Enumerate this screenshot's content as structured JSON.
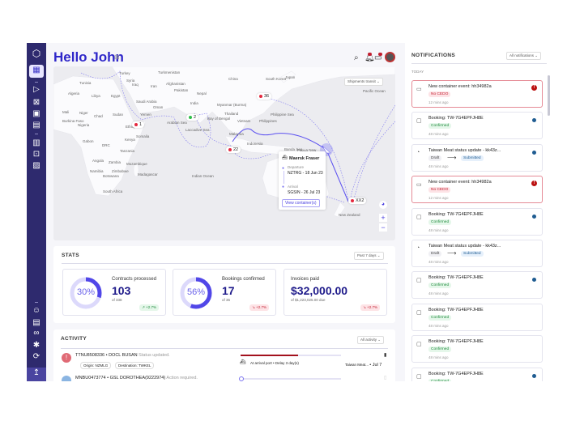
{
  "header": {
    "title": "Hello John"
  },
  "map": {
    "dropdown": "Shipments transit",
    "labels": [
      "Turkey",
      "Turkmenistan",
      "China",
      "South Korea",
      "Japan",
      "Tunisia",
      "Syria",
      "Iraq",
      "Iran",
      "Afghanistan",
      "Pakistan",
      "Nepal",
      "Algeria",
      "Libya",
      "Egypt",
      "Saudi Arabia",
      "Oman",
      "India",
      "Myanmar (Burma)",
      "Mali",
      "Niger",
      "Chad",
      "Sudan",
      "Yemen",
      "Thailand",
      "Vietnam",
      "Philippines",
      "Burkina Faso",
      "Nigeria",
      "Ethiopia",
      "Somalia",
      "Malaysia",
      "Kenya",
      "Gabon",
      "DRC",
      "Indonesia",
      "Tanzania",
      "Papua New",
      "Angola",
      "Zambia",
      "Mozambique",
      "Namibia",
      "Zimbabwe",
      "Madagascar",
      "Botswana",
      "Indian Ocean",
      "South Africa",
      "New Zealand",
      "Pacific Ocean",
      "Arabian Sea",
      "Bay of Bengal",
      "Philippine Sea",
      "Laccadive Sea",
      "Banda Sea",
      "Australia"
    ],
    "pins": [
      {
        "label": "1",
        "color": "#e5283f"
      },
      {
        "label": "2",
        "color": "#2fbf4a"
      },
      {
        "label": "36",
        "color": "#e5283f"
      },
      {
        "label": "22",
        "color": "#e5283f"
      },
      {
        "label": "XX2",
        "color": "#e5283f"
      }
    ],
    "popup": {
      "vessel": "Maersk Fraser",
      "departure_label": "Departure",
      "departure": "NZTRG - 18 Jun 23",
      "arrival_label": "Arrival",
      "arrival": "SGSIN - 26 Jul 23",
      "button": "View container(s)"
    },
    "zoom_in": "+",
    "zoom_out": "−"
  },
  "stats": {
    "title": "STATS",
    "range": "Past 7 days",
    "cards": [
      {
        "label": "Contracts processed",
        "percent": "30%",
        "fraction": 0.3,
        "value": "103",
        "sub": "of 338",
        "trend": "+2.7%",
        "trend_dir": "up"
      },
      {
        "label": "Bookings confirmed",
        "percent": "56%",
        "fraction": 0.56,
        "value": "17",
        "sub": "of 36",
        "trend": "+2.7%",
        "trend_dir": "down"
      },
      {
        "label": "Invoices paid",
        "value": "$32,000.00",
        "sub": "of $1,223,025.00 due",
        "trend": "+2.7%",
        "trend_dir": "down"
      }
    ]
  },
  "activity": {
    "title": "ACTIVITY",
    "filter": "All activity",
    "rows": [
      {
        "id": "TTNU8508336",
        "vessel": "DOCL BUSAN",
        "status": "Status updated.",
        "origin": "Origin: NZMLG",
        "destination": "Destination: TWKEL",
        "progress_text": "At arrival port • Delay 3 day(s)",
        "progress": 0.57,
        "customer": "Taiwan Meat...",
        "date": "• Jul 7"
      },
      {
        "id": "MNBU0473774",
        "vessel": "GSL DOROTHEA(9222974)",
        "status": "Action required.",
        "progress": 0.0
      }
    ]
  },
  "notifications": {
    "title": "NOTIFICATIONS",
    "filter": "All notifications",
    "group": "TODAY",
    "items": [
      {
        "title": "New container event: hh34982a",
        "tag": "No CEDO",
        "tag2": "",
        "time": "12 mins ago",
        "type": "error"
      },
      {
        "title": "Booking: TW-7G4EPFJH8E",
        "tag": "Confirmed",
        "tag2": "",
        "time": "48 mins ago",
        "type": "unread"
      },
      {
        "title": "Taiwan Meat status update - kk43z...",
        "tag": "Draft",
        "tag2": "Submitted",
        "time": "48 mins ago",
        "type": "unread"
      },
      {
        "title": "New container event: hh34982a",
        "tag": "No CEDO",
        "tag2": "",
        "time": "12 mins ago",
        "type": "error"
      },
      {
        "title": "Booking: TW-7G4EPFJH8E",
        "tag": "Confirmed",
        "tag2": "",
        "time": "48 mins ago",
        "type": "unread"
      },
      {
        "title": "Taiwan Meat status update - kk43z...",
        "tag": "Draft",
        "tag2": "Submitted",
        "time": "48 mins ago",
        "type": "read"
      },
      {
        "title": "Booking: TW-7G4EPFJH8E",
        "tag": "Confirmed",
        "tag2": "",
        "time": "48 mins ago",
        "type": "unread"
      },
      {
        "title": "Booking: TW-7G4EPFJH8E",
        "tag": "Confirmed",
        "tag2": "",
        "time": "48 mins ago",
        "type": "read"
      },
      {
        "title": "Booking: TW-7G4EPFJH8E",
        "tag": "Confirmed",
        "tag2": "",
        "time": "48 mins ago",
        "type": "read"
      },
      {
        "title": "Booking: TW-7G4EPFJH8E",
        "tag": "Confirmed",
        "tag2": "",
        "time": "48 mins ago",
        "type": "unread"
      }
    ]
  },
  "colors": {
    "brand": "#2f27c9",
    "sidebar": "#2e2a6e",
    "error": "#c21d2f",
    "success": "#1e8a3c"
  }
}
